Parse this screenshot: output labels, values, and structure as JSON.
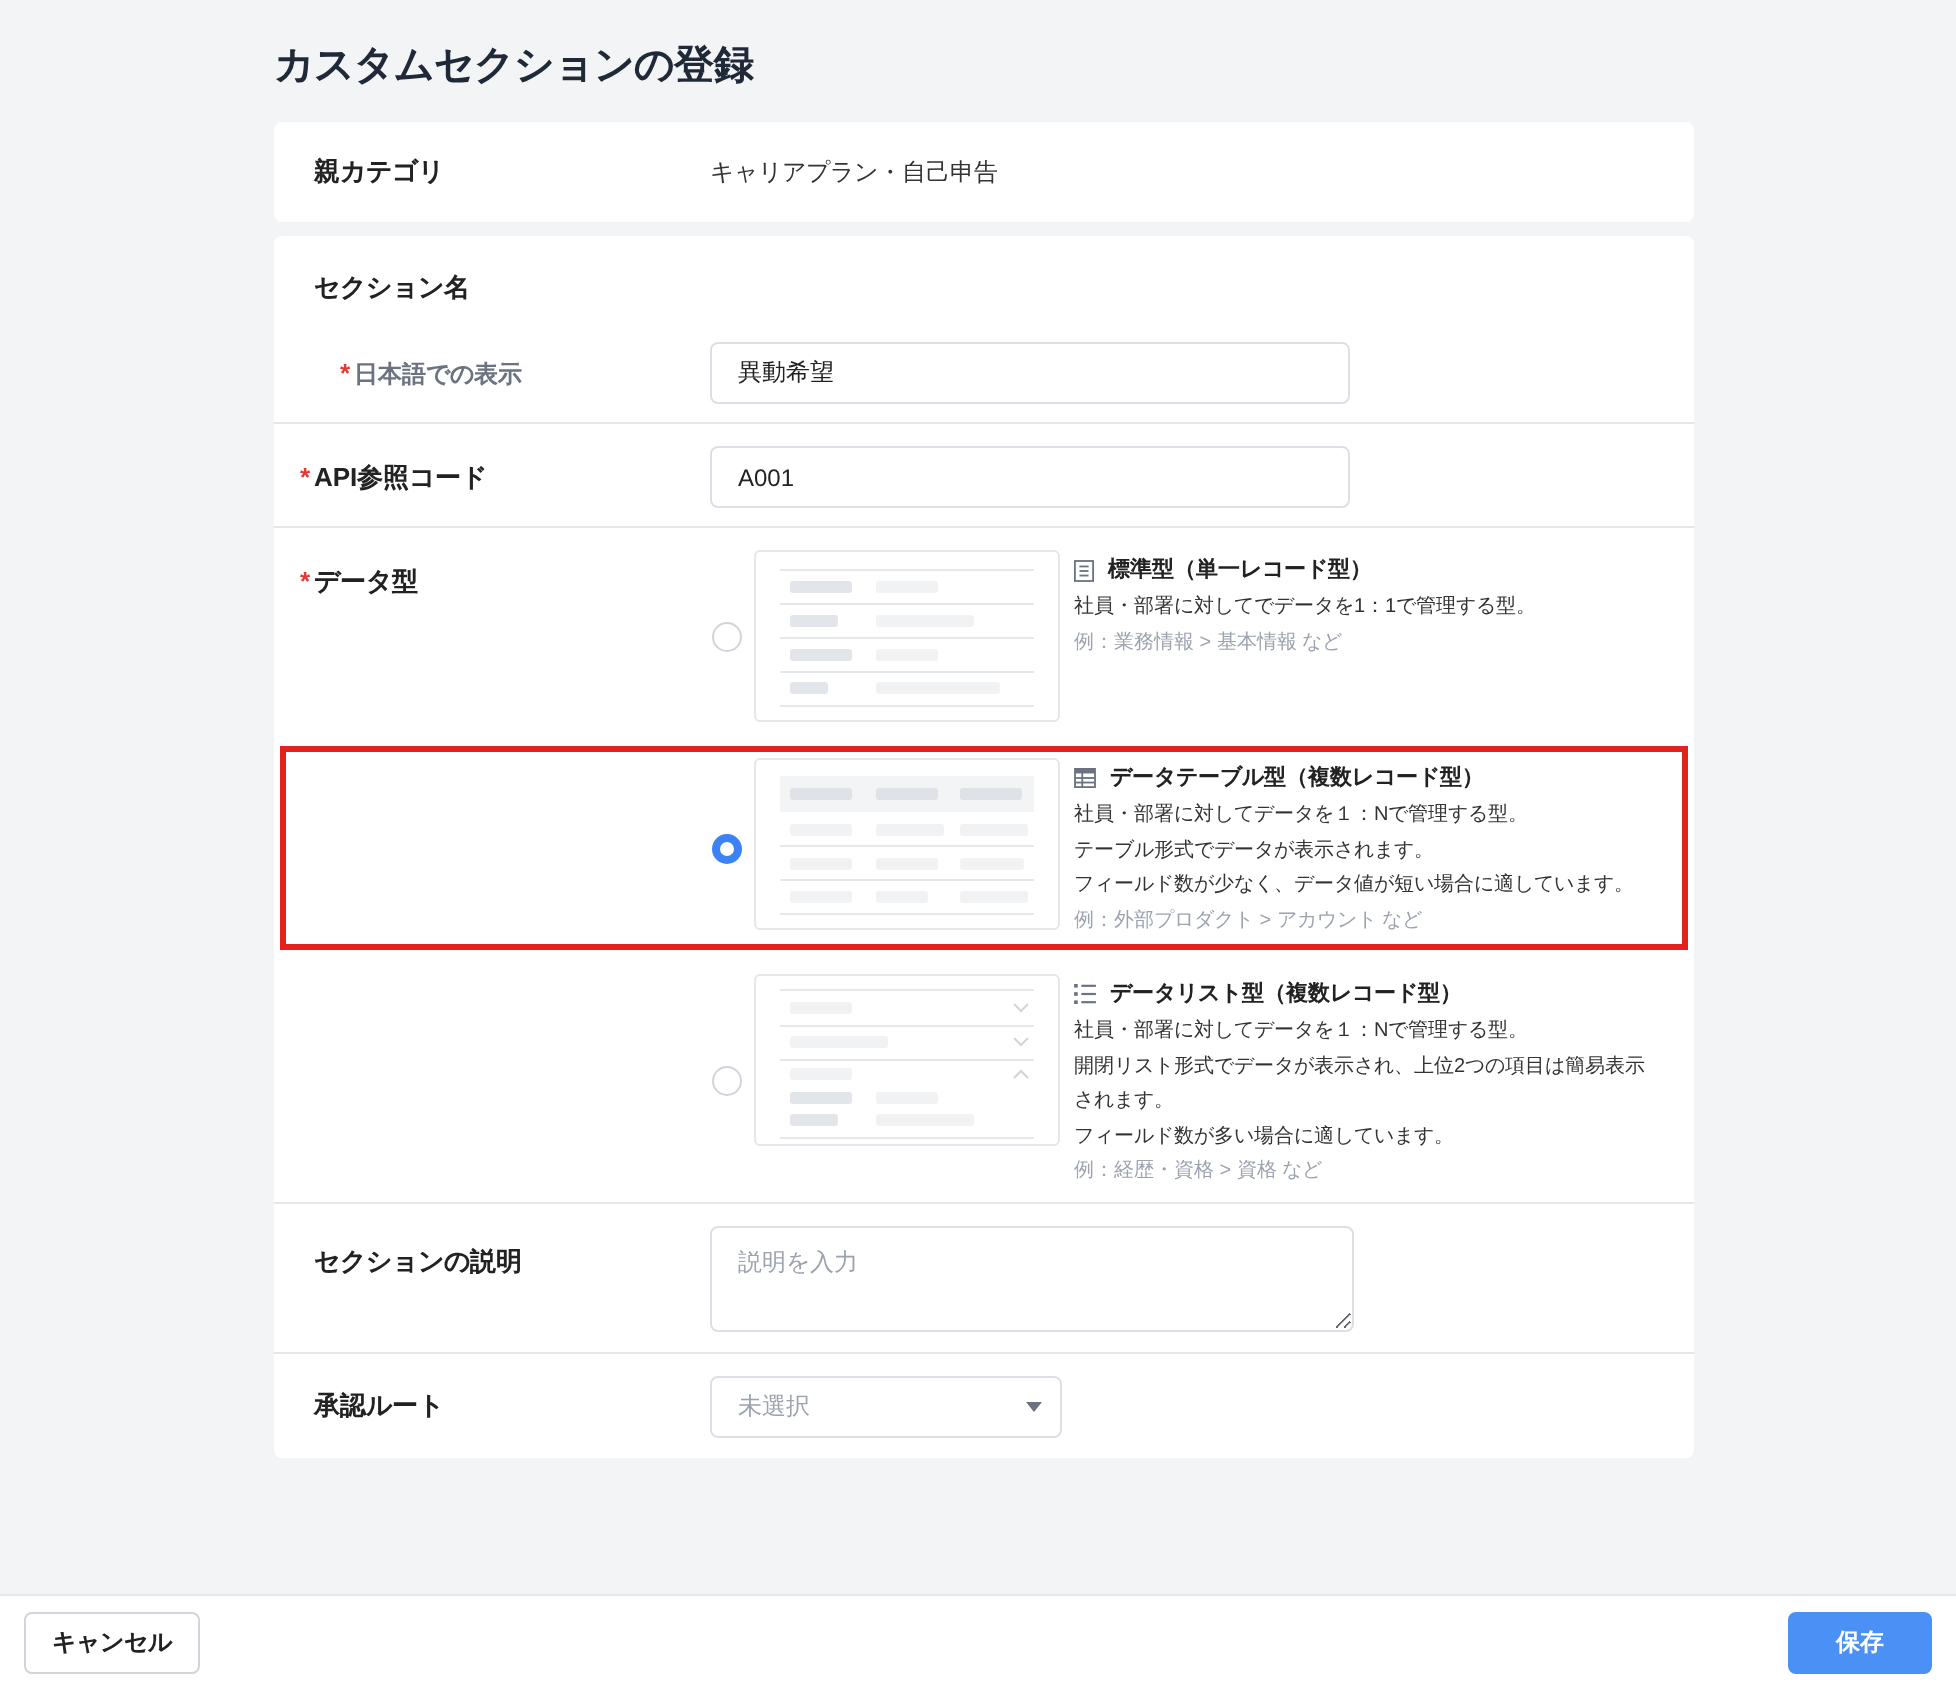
{
  "page": {
    "title": "カスタムセクションの登録"
  },
  "parent_category": {
    "label": "親カテゴリ",
    "value": "キャリアプラン・自己申告"
  },
  "section_name": {
    "label": "セクション名",
    "fields": [
      {
        "required_mark": "*",
        "label": "日本語での表示",
        "value": "異動希望"
      }
    ]
  },
  "api_code": {
    "required_mark": "*",
    "label": "API参照コード",
    "value": "A001"
  },
  "data_type": {
    "required_mark": "*",
    "label": "データ型",
    "options": [
      {
        "kind": "standard",
        "selected": false,
        "highlighted": false,
        "title": "標準型（単一レコード型）",
        "lines": [
          "社員・部署に対してでデータを1：1で管理する型。"
        ],
        "example": "例：業務情報 > 基本情報 など"
      },
      {
        "kind": "table",
        "selected": true,
        "highlighted": true,
        "title": "データテーブル型（複数レコード型）",
        "lines": [
          "社員・部署に対してデータを１：Nで管理する型。",
          "テーブル形式でデータが表示されます。",
          "フィールド数が少なく、データ値が短い場合に適しています。"
        ],
        "example": "例：外部プロダクト > アカウント など"
      },
      {
        "kind": "list",
        "selected": false,
        "highlighted": false,
        "title": "データリスト型（複数レコード型）",
        "lines": [
          "社員・部署に対してデータを１：Nで管理する型。",
          "開閉リスト形式でデータが表示され、上位2つの項目は簡易表示されます。",
          "フィールド数が多い場合に適しています。"
        ],
        "example": "例：経歴・資格 > 資格 など"
      }
    ]
  },
  "description": {
    "label": "セクションの説明",
    "placeholder": "説明を入力"
  },
  "approval_route": {
    "label": "承認ルート",
    "placeholder": "未選択"
  },
  "footer": {
    "buttons": [
      {
        "kind": "secondary",
        "label": "キャンセル"
      },
      {
        "kind": "primary",
        "label": "保存"
      }
    ]
  }
}
